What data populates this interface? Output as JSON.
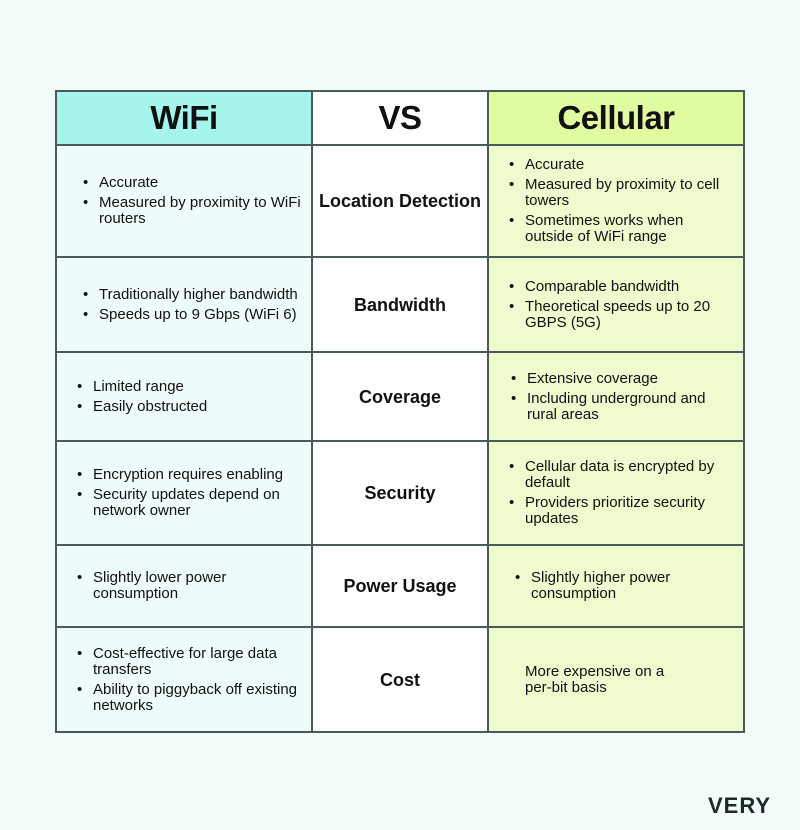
{
  "header": {
    "left": "WiFi",
    "middle": "VS",
    "right": "Cellular"
  },
  "colors": {
    "wifi_header": "#a6f5ec",
    "cellular_header": "#e1fca0",
    "wifi_cell": "#eefcfb",
    "cellular_cell": "#eefbcf",
    "border": "#4a5a57"
  },
  "rows": [
    {
      "category": "Location Detection",
      "wifi": [
        "Accurate",
        "Measured by proximity to WiFi routers"
      ],
      "cellular": [
        "Accurate",
        "Measured by proximity to cell towers",
        "Sometimes works when outside of WiFi range"
      ]
    },
    {
      "category": "Bandwidth",
      "wifi": [
        "Traditionally higher bandwidth",
        "Speeds up to 9 Gbps (WiFi 6)"
      ],
      "cellular": [
        "Comparable bandwidth",
        "Theoretical speeds up to 20 GBPS (5G)"
      ]
    },
    {
      "category": "Coverage",
      "wifi": [
        "Limited range",
        "Easily obstructed"
      ],
      "cellular": [
        "Extensive coverage",
        "Including underground and rural areas"
      ]
    },
    {
      "category": "Security",
      "wifi": [
        "Encryption requires enabling",
        "Security updates depend on network owner"
      ],
      "cellular": [
        "Cellular data is encrypted by default",
        "Providers prioritize security updates"
      ]
    },
    {
      "category": "Power Usage",
      "wifi": [
        "Slightly lower power consumption"
      ],
      "cellular": [
        "Slightly higher power consumption"
      ]
    },
    {
      "category": "Cost",
      "wifi": [
        "Cost-effective for large data transfers",
        "Ability to piggyback off existing networks"
      ],
      "cellular_text": "More expensive on a per-bit basis"
    }
  ],
  "logo": "VERY"
}
